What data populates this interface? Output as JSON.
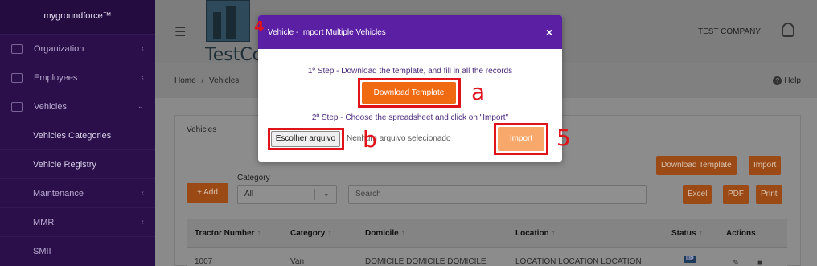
{
  "sidebar": {
    "brand": "mygroundforce™",
    "items": [
      {
        "label": "Organization",
        "chevron": "‹"
      },
      {
        "label": "Employees",
        "chevron": "‹"
      },
      {
        "label": "Vehicles",
        "chevron": "⌄"
      },
      {
        "label": "Vehicles Categories"
      },
      {
        "label": "Vehicle Registry"
      },
      {
        "label": "Maintenance",
        "chevron": "‹"
      },
      {
        "label": "MMR",
        "chevron": "‹"
      },
      {
        "label": "SMII"
      }
    ]
  },
  "header": {
    "menu_icon": "☰",
    "logo_text": "TestCo",
    "company": "TEST COMPANY"
  },
  "breadcrumb": {
    "home": "Home",
    "separator": "/",
    "current": "Vehicles",
    "help": "Help"
  },
  "main": {
    "card_title": "Vehicles",
    "add_button": "+ Add",
    "category_label": "Category",
    "category_value": "All",
    "search_placeholder": "Search",
    "download_template": "Download Template",
    "import": "Import",
    "excel": "Excel",
    "pdf": "PDF",
    "print": "Print",
    "columns": [
      "Tractor Number",
      "Category",
      "Domicile",
      "Location",
      "Status",
      "Actions"
    ],
    "rows": [
      {
        "tractor": "1007",
        "category": "Van",
        "domicile": "DOMICILE DOMICILE DOMICILE",
        "location": "LOCATION LOCATION LOCATION",
        "status": "UP"
      }
    ]
  },
  "modal": {
    "title": "Vehicle - Import Multiple Vehicles",
    "close": "×",
    "step1": "1º Step - Download the template, and fill in all the records",
    "download_button": "Download Template",
    "step2": "2º Step - Choose the spreadsheet and click on \"Import\"",
    "file_button": "Escolher arquivo",
    "file_status": "Nenhum arquivo selecionado",
    "import_button": "Import"
  },
  "annotations": {
    "four": "4",
    "a": "a",
    "b": "b",
    "five": "5"
  },
  "colors": {
    "sidebar": "#2a0f4a",
    "modal_header": "#5b1fa3",
    "accent_orange": "#f06a12",
    "annotation_red": "#e0131b"
  }
}
